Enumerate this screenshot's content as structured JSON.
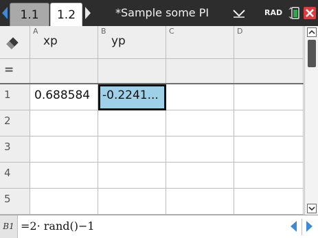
{
  "tabs": [
    {
      "label": "1.1",
      "active": false
    },
    {
      "label": "1.2",
      "active": true
    }
  ],
  "document_title": "*Sample some PI",
  "angle_mode": "RAD",
  "spreadsheet": {
    "columns": [
      {
        "letter": "A",
        "name": "xp"
      },
      {
        "letter": "B",
        "name": "yp"
      },
      {
        "letter": "C",
        "name": ""
      },
      {
        "letter": "D",
        "name": ""
      }
    ],
    "formula_row_symbol": "=",
    "rows": [
      {
        "number": "1",
        "cells": [
          "0.688584",
          "-0.2241...",
          "",
          ""
        ]
      },
      {
        "number": "2",
        "cells": [
          "",
          "",
          "",
          ""
        ]
      },
      {
        "number": "3",
        "cells": [
          "",
          "",
          "",
          ""
        ]
      },
      {
        "number": "4",
        "cells": [
          "",
          "",
          "",
          ""
        ]
      },
      {
        "number": "5",
        "cells": [
          "",
          "",
          "",
          ""
        ]
      }
    ],
    "selected_cell": "B1"
  },
  "entry_line": {
    "cell_ref": "B1",
    "formula": "=2· rand()−1"
  },
  "colors": {
    "title_bar": "#2d2d2d",
    "selected_cell": "#9ed0e8",
    "nav_arrow": "#3f8ad6",
    "close_button": "#e0393e",
    "battery": "#2fa84f"
  }
}
